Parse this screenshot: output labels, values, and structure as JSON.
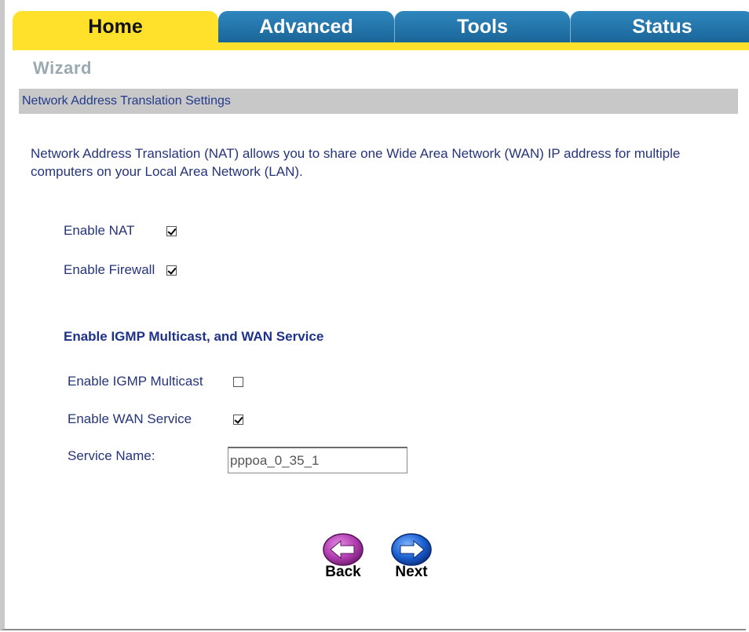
{
  "tabs": [
    {
      "label": "Home",
      "active": true
    },
    {
      "label": "Advanced",
      "active": false
    },
    {
      "label": "Tools",
      "active": false
    },
    {
      "label": "Status",
      "active": false
    }
  ],
  "page_title": "Wizard",
  "section_title": "Network Address Translation Settings",
  "description": "Network Address Translation (NAT) allows you to share one Wide Area Network (WAN) IP address for multiple computers on your Local Area Network (LAN).",
  "nat": {
    "label": "Enable NAT",
    "checked": true
  },
  "firewall": {
    "label": "Enable Firewall",
    "checked": true
  },
  "igmp_heading": "Enable IGMP Multicast, and WAN Service",
  "igmp": {
    "label": "Enable IGMP Multicast",
    "checked": false
  },
  "wan": {
    "label": "Enable WAN Service",
    "checked": true
  },
  "service_name": {
    "label": "Service Name:",
    "value": "pppoa_0_35_1"
  },
  "buttons": {
    "back": "Back",
    "next": "Next"
  },
  "colors": {
    "tab_active": "#ffe12b",
    "tab_inactive": "#2173a8",
    "text_blue": "#26347a",
    "back_icon": "#b03db0",
    "next_icon": "#1a5fd0"
  }
}
